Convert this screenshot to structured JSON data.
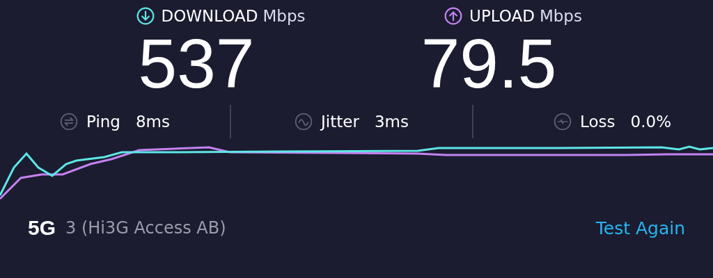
{
  "speeds": [
    {
      "kind": "download",
      "label": "DOWNLOAD",
      "unit": "Mbps",
      "value": "537",
      "color": "#5ee6e6"
    },
    {
      "kind": "upload",
      "label": "UPLOAD",
      "unit": "Mbps",
      "value": "79.5",
      "color": "#c383f0"
    }
  ],
  "metrics": [
    {
      "kind": "ping",
      "label": "Ping",
      "value": "8ms"
    },
    {
      "kind": "jitter",
      "label": "Jitter",
      "value": "3ms"
    },
    {
      "kind": "loss",
      "label": "Loss",
      "value": "0.0%"
    }
  ],
  "network": {
    "type": "5G",
    "name": "3 (Hi3G Access AB)"
  },
  "button": "Test Again"
}
